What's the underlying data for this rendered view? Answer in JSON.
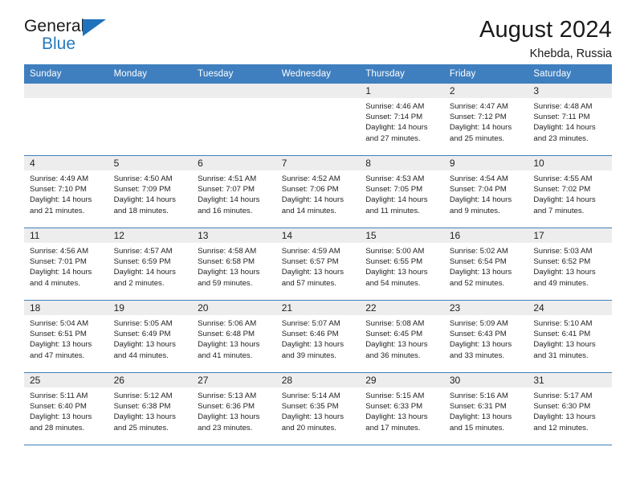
{
  "brand": {
    "name_part1": "General",
    "name_part2": "Blue",
    "accent_color": "#2579be",
    "triangle_color": "#1f72bb"
  },
  "header": {
    "title": "August 2024",
    "subtitle": "Khebda, Russia"
  },
  "calendar": {
    "header_bg": "#3f7fbf",
    "daynum_bg": "#ededed",
    "weekdays": [
      "Sunday",
      "Monday",
      "Tuesday",
      "Wednesday",
      "Thursday",
      "Friday",
      "Saturday"
    ],
    "weeks": [
      [
        {
          "day": "",
          "empty": true
        },
        {
          "day": "",
          "empty": true
        },
        {
          "day": "",
          "empty": true
        },
        {
          "day": "",
          "empty": true
        },
        {
          "day": "1",
          "sunrise": "Sunrise: 4:46 AM",
          "sunset": "Sunset: 7:14 PM",
          "daylight": "Daylight: 14 hours and 27 minutes."
        },
        {
          "day": "2",
          "sunrise": "Sunrise: 4:47 AM",
          "sunset": "Sunset: 7:12 PM",
          "daylight": "Daylight: 14 hours and 25 minutes."
        },
        {
          "day": "3",
          "sunrise": "Sunrise: 4:48 AM",
          "sunset": "Sunset: 7:11 PM",
          "daylight": "Daylight: 14 hours and 23 minutes."
        }
      ],
      [
        {
          "day": "4",
          "sunrise": "Sunrise: 4:49 AM",
          "sunset": "Sunset: 7:10 PM",
          "daylight": "Daylight: 14 hours and 21 minutes."
        },
        {
          "day": "5",
          "sunrise": "Sunrise: 4:50 AM",
          "sunset": "Sunset: 7:09 PM",
          "daylight": "Daylight: 14 hours and 18 minutes."
        },
        {
          "day": "6",
          "sunrise": "Sunrise: 4:51 AM",
          "sunset": "Sunset: 7:07 PM",
          "daylight": "Daylight: 14 hours and 16 minutes."
        },
        {
          "day": "7",
          "sunrise": "Sunrise: 4:52 AM",
          "sunset": "Sunset: 7:06 PM",
          "daylight": "Daylight: 14 hours and 14 minutes."
        },
        {
          "day": "8",
          "sunrise": "Sunrise: 4:53 AM",
          "sunset": "Sunset: 7:05 PM",
          "daylight": "Daylight: 14 hours and 11 minutes."
        },
        {
          "day": "9",
          "sunrise": "Sunrise: 4:54 AM",
          "sunset": "Sunset: 7:04 PM",
          "daylight": "Daylight: 14 hours and 9 minutes."
        },
        {
          "day": "10",
          "sunrise": "Sunrise: 4:55 AM",
          "sunset": "Sunset: 7:02 PM",
          "daylight": "Daylight: 14 hours and 7 minutes."
        }
      ],
      [
        {
          "day": "11",
          "sunrise": "Sunrise: 4:56 AM",
          "sunset": "Sunset: 7:01 PM",
          "daylight": "Daylight: 14 hours and 4 minutes."
        },
        {
          "day": "12",
          "sunrise": "Sunrise: 4:57 AM",
          "sunset": "Sunset: 6:59 PM",
          "daylight": "Daylight: 14 hours and 2 minutes."
        },
        {
          "day": "13",
          "sunrise": "Sunrise: 4:58 AM",
          "sunset": "Sunset: 6:58 PM",
          "daylight": "Daylight: 13 hours and 59 minutes."
        },
        {
          "day": "14",
          "sunrise": "Sunrise: 4:59 AM",
          "sunset": "Sunset: 6:57 PM",
          "daylight": "Daylight: 13 hours and 57 minutes."
        },
        {
          "day": "15",
          "sunrise": "Sunrise: 5:00 AM",
          "sunset": "Sunset: 6:55 PM",
          "daylight": "Daylight: 13 hours and 54 minutes."
        },
        {
          "day": "16",
          "sunrise": "Sunrise: 5:02 AM",
          "sunset": "Sunset: 6:54 PM",
          "daylight": "Daylight: 13 hours and 52 minutes."
        },
        {
          "day": "17",
          "sunrise": "Sunrise: 5:03 AM",
          "sunset": "Sunset: 6:52 PM",
          "daylight": "Daylight: 13 hours and 49 minutes."
        }
      ],
      [
        {
          "day": "18",
          "sunrise": "Sunrise: 5:04 AM",
          "sunset": "Sunset: 6:51 PM",
          "daylight": "Daylight: 13 hours and 47 minutes."
        },
        {
          "day": "19",
          "sunrise": "Sunrise: 5:05 AM",
          "sunset": "Sunset: 6:49 PM",
          "daylight": "Daylight: 13 hours and 44 minutes."
        },
        {
          "day": "20",
          "sunrise": "Sunrise: 5:06 AM",
          "sunset": "Sunset: 6:48 PM",
          "daylight": "Daylight: 13 hours and 41 minutes."
        },
        {
          "day": "21",
          "sunrise": "Sunrise: 5:07 AM",
          "sunset": "Sunset: 6:46 PM",
          "daylight": "Daylight: 13 hours and 39 minutes."
        },
        {
          "day": "22",
          "sunrise": "Sunrise: 5:08 AM",
          "sunset": "Sunset: 6:45 PM",
          "daylight": "Daylight: 13 hours and 36 minutes."
        },
        {
          "day": "23",
          "sunrise": "Sunrise: 5:09 AM",
          "sunset": "Sunset: 6:43 PM",
          "daylight": "Daylight: 13 hours and 33 minutes."
        },
        {
          "day": "24",
          "sunrise": "Sunrise: 5:10 AM",
          "sunset": "Sunset: 6:41 PM",
          "daylight": "Daylight: 13 hours and 31 minutes."
        }
      ],
      [
        {
          "day": "25",
          "sunrise": "Sunrise: 5:11 AM",
          "sunset": "Sunset: 6:40 PM",
          "daylight": "Daylight: 13 hours and 28 minutes."
        },
        {
          "day": "26",
          "sunrise": "Sunrise: 5:12 AM",
          "sunset": "Sunset: 6:38 PM",
          "daylight": "Daylight: 13 hours and 25 minutes."
        },
        {
          "day": "27",
          "sunrise": "Sunrise: 5:13 AM",
          "sunset": "Sunset: 6:36 PM",
          "daylight": "Daylight: 13 hours and 23 minutes."
        },
        {
          "day": "28",
          "sunrise": "Sunrise: 5:14 AM",
          "sunset": "Sunset: 6:35 PM",
          "daylight": "Daylight: 13 hours and 20 minutes."
        },
        {
          "day": "29",
          "sunrise": "Sunrise: 5:15 AM",
          "sunset": "Sunset: 6:33 PM",
          "daylight": "Daylight: 13 hours and 17 minutes."
        },
        {
          "day": "30",
          "sunrise": "Sunrise: 5:16 AM",
          "sunset": "Sunset: 6:31 PM",
          "daylight": "Daylight: 13 hours and 15 minutes."
        },
        {
          "day": "31",
          "sunrise": "Sunrise: 5:17 AM",
          "sunset": "Sunset: 6:30 PM",
          "daylight": "Daylight: 13 hours and 12 minutes."
        }
      ]
    ]
  }
}
